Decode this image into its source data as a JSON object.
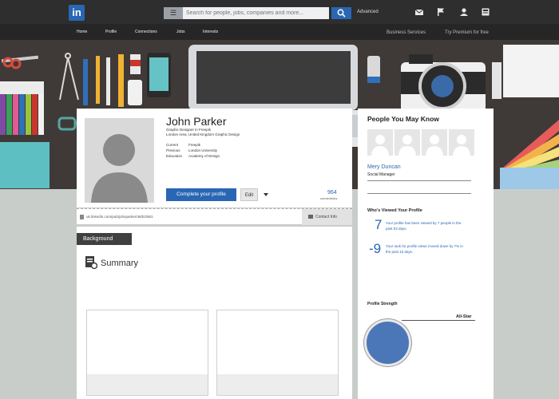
{
  "topbar": {
    "logo": "in",
    "search": {
      "category": "☰",
      "placeholder": "Search for people, jobs, companies and more..."
    },
    "advanced": "Advanced",
    "icons": [
      "messages-icon",
      "flag-icon",
      "add-connection-icon",
      "settings-icon"
    ]
  },
  "nav": {
    "items": [
      "Home",
      "Profile",
      "Connections",
      "Jobs",
      "Interests"
    ],
    "right": [
      "Business Services",
      "Try Premium for free"
    ]
  },
  "profile": {
    "name": "John Parker",
    "headline": "Graphic Designer in Freepik",
    "location": "London Area, United Kingdom  Graphic Design",
    "details": [
      {
        "label": "Current",
        "value": "Freepik"
      },
      {
        "label": "Previous",
        "value": "London University"
      },
      {
        "label": "Education",
        "value": "Academy of Design"
      }
    ],
    "complete_button": "Complete your profile",
    "edit_button": "Edit",
    "connections_count": "964",
    "connections_label": "connections",
    "public_url": "uk.linkedin.com/pub/johnparker/46/b2/681",
    "contact_info": "Contact Info"
  },
  "main": {
    "section_tab": "Background",
    "summary_title": "Summary"
  },
  "sidebar": {
    "pymk_title": "People You May Know",
    "suggestion_name": "Mery Duncan",
    "suggestion_title": "Social Manager",
    "wvp_title": "Who's Viewed Your Profile",
    "stats": [
      {
        "value": "7",
        "text": "Your profile has been viewed by 7 people in the past 53 days."
      },
      {
        "value": "-9",
        "text": "Your rank for profile views moved down by 7% in the past 15 days."
      }
    ],
    "strength_title": "Profile Strength",
    "strength_level": "All-Star"
  },
  "colors": {
    "brand": "#2a66b4",
    "topbar": "#2e2e2e",
    "desk": "#3f3a38"
  }
}
